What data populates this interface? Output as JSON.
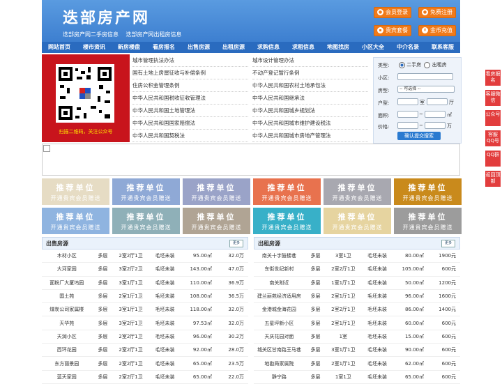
{
  "header": {
    "logo": "迭部房产网",
    "tagline": [
      "迭部房产网二手房信息",
      "迭部房产网出租房信息"
    ],
    "buttons": [
      {
        "icon": "user-icon",
        "label": "会员登录"
      },
      {
        "icon": "user-icon",
        "label": "免费注册"
      },
      {
        "icon": "gift-icon",
        "label": "贵宾套餐"
      },
      {
        "icon": "coin-icon",
        "label": "金币充值"
      }
    ]
  },
  "nav": [
    "网站首页",
    "楼市资讯",
    "新房楼盘",
    "看房报名",
    "出售房源",
    "出租房源",
    "求购信息",
    "求租信息",
    "地图找房",
    "小区大全",
    "中介名录",
    "联系客服"
  ],
  "qr_caption": "扫描二维码，关注公众号",
  "laws": [
    [
      "城市管理执法办法",
      "城市设计管理办法"
    ],
    [
      "国有土地上房屋征收与补偿条例",
      "不动产登记暂行条例"
    ],
    [
      "住房公积金管理条例",
      "中华人民共和国农村土地承包法"
    ],
    [
      "中华人民共和国税收征收管理法",
      "中华人民共和国继承法"
    ],
    [
      "中华人民共和国土地管理法",
      "中华人民共和国城乡规划法"
    ],
    [
      "中华人民共和国国家赔偿法",
      "中华人民共和国城市维护建设税法"
    ],
    [
      "中华人民共和国契税法",
      "中华人民共和国城市房地产管理法"
    ]
  ],
  "search": {
    "type_label": "类型:",
    "opt_sale": "二手房",
    "opt_rent": "出租房",
    "community_label": "小区:",
    "housetype_label": "房型:",
    "housetype_value": "-- 可选择 --",
    "layout_label": "户型:",
    "room_unit": "室",
    "hall_unit": "厅",
    "area_label": "面积:",
    "area_unit": "㎡",
    "price_label": "价格:",
    "price_unit": "万",
    "range_sep": "~",
    "submit": "确认提交搜索"
  },
  "promo": {
    "title": "推荐单位",
    "subtitle": "开通贵宾会员赠送",
    "colors": [
      "#e6dcc4",
      "#8fa9d6",
      "#9aa3c8",
      "#e8724e",
      "#a8a8b0",
      "#c98a1c",
      "#8fb4e0",
      "#8fb0b8",
      "#b0a494",
      "#38b0c8",
      "#e6d4a0",
      "#9c9c9c"
    ]
  },
  "sale": {
    "title": "出售房源",
    "more": "更多",
    "rows": [
      [
        "木材小区",
        "多层",
        "2室2厅1卫",
        "毛坯未装",
        "95.00㎡",
        "32.0万"
      ],
      [
        "大河家园",
        "多层",
        "3室2厅2卫",
        "毛坯未装",
        "143.00㎡",
        "47.0万"
      ],
      [
        "面粉厂大厦坞园",
        "多层",
        "3室1厅1卫",
        "毛坯未装",
        "110.00㎡",
        "36.9万"
      ],
      [
        "国土苑",
        "多层",
        "2室1厅1卫",
        "毛坯未装",
        "108.00㎡",
        "36.5万"
      ],
      [
        "煤炭公司家属楼",
        "多层",
        "3室1厅1卫",
        "毛坯未装",
        "118.00㎡",
        "32.0万"
      ],
      [
        "天华苑",
        "多层",
        "3室2厅1卫",
        "毛坯未装",
        "97.53㎡",
        "32.0万"
      ],
      [
        "天润小区",
        "多层",
        "2室2厅1卫",
        "毛坯未装",
        "96.00㎡",
        "30.2万"
      ],
      [
        "西环花园",
        "多层",
        "2室2厅1卫",
        "毛坯未装",
        "92.00㎡",
        "28.0万"
      ],
      [
        "东方丽景园",
        "多层",
        "2室2厅1卫",
        "毛坯未装",
        "65.00㎡",
        "23.5万"
      ],
      [
        "蓝天家园",
        "多层",
        "2室2厅1卫",
        "毛坯未装",
        "65.00㎡",
        "22.0万"
      ]
    ]
  },
  "rent": {
    "title": "出租房源",
    "more": "更多",
    "rows": [
      [
        "南关十字鼓楼巷",
        "多层",
        "3室1卫",
        "毛坯未装",
        "80.00㎡",
        "1900元"
      ],
      [
        "东街世纪新村",
        "多层",
        "2室2厅1卫",
        "毛坯未装",
        "105.00㎡",
        "600元"
      ],
      [
        "南关附近",
        "多层",
        "1室1厅1卫",
        "毛坯未装",
        "50.00㎡",
        "1200元"
      ],
      [
        "建兰丽苑经济适用房",
        "多层",
        "2室1厅1卫",
        "毛坯未装",
        "96.00㎡",
        "1600元"
      ],
      [
        "金港城金海花园",
        "多层",
        "2室2厅1卫",
        "毛坯未装",
        "86.00㎡",
        "1400元"
      ],
      [
        "五星坪新小区",
        "多层",
        "2室1厅1卫",
        "毛坯未装",
        "60.00㎡",
        "600元"
      ],
      [
        "天庆花园对面",
        "多层",
        "1室",
        "毛坯未装",
        "15.00㎡",
        "600元"
      ],
      [
        "城关区甘南路王马巷",
        "多层",
        "3室1厅1卫",
        "毛坯未装",
        "90.00㎡",
        "600元"
      ],
      [
        "地勘局家属院",
        "多层",
        "2室1厅1卫",
        "毛坯未装",
        "62.00㎡",
        "600元"
      ],
      [
        "静宁路",
        "多层",
        "1室1卫",
        "毛坯未装",
        "65.00㎡",
        "600元"
      ]
    ]
  },
  "side": [
    "看房报名",
    "客服微信",
    "公众号",
    "客服QQ号",
    "QQ群",
    "返回顶部"
  ]
}
